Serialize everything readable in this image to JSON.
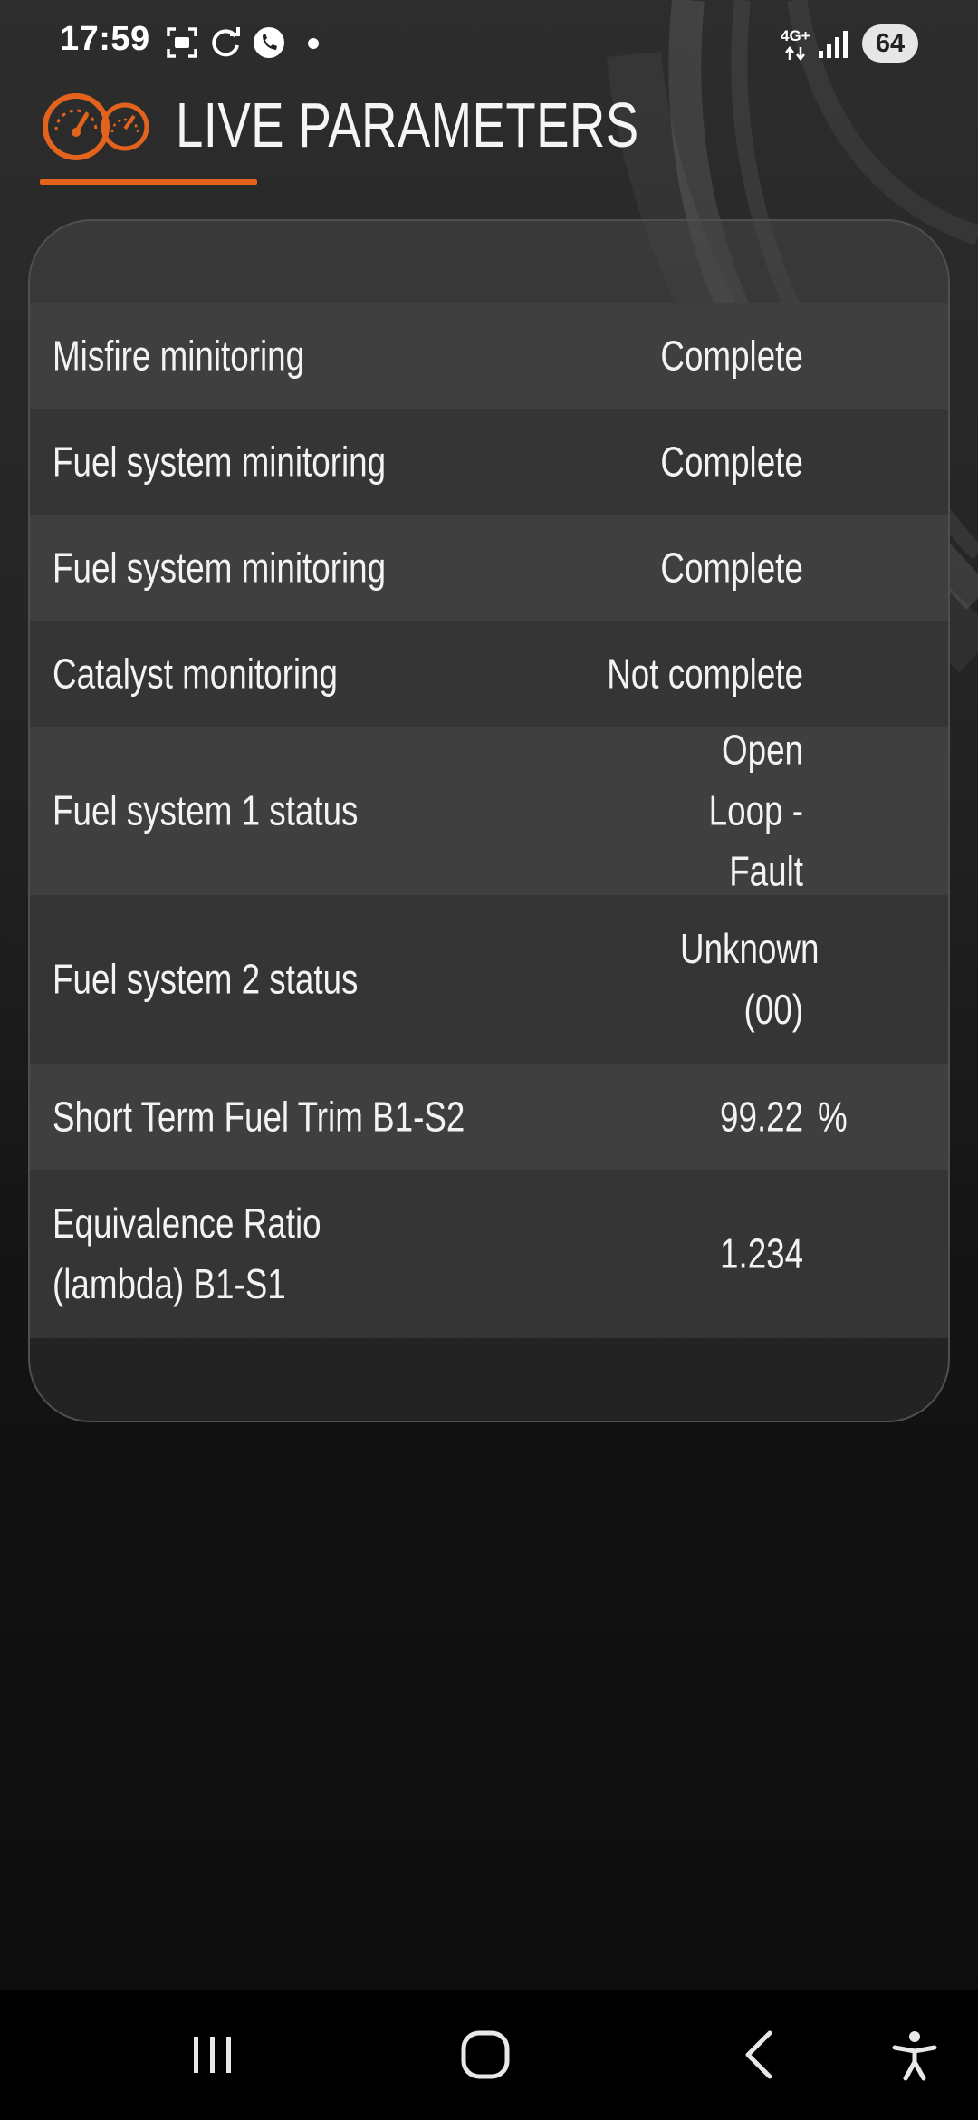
{
  "status_bar": {
    "time": "17:59",
    "icons": [
      "screenshot-icon",
      "sync-icon",
      "phone-call-icon",
      "notification-dot"
    ],
    "network_label": "4G+",
    "signal_icon": "signal-bars-icon",
    "battery": "64"
  },
  "header": {
    "logo_icon": "gauges-icon",
    "title": "LIVE PARAMETERS",
    "accent_color": "#e3621c"
  },
  "parameters": [
    {
      "label": "Misfire minitoring",
      "value": "Complete",
      "unit": ""
    },
    {
      "label": "Fuel system minitoring",
      "value": "Complete",
      "unit": ""
    },
    {
      "label": "Fuel system minitoring",
      "value": "Complete",
      "unit": ""
    },
    {
      "label": "Catalyst monitoring",
      "value": "Not complete",
      "unit": ""
    },
    {
      "label": "Fuel system 1 status",
      "value": "Open Loop - Fault",
      "unit": ""
    },
    {
      "label": "Fuel system 2 status",
      "value": "Unknown (00)",
      "unit": ""
    },
    {
      "label": "Short Term Fuel Trim B1-S2",
      "value": "99.22",
      "unit": "%"
    },
    {
      "label": "Equivalence Ratio (lambda) B1-S1",
      "value": "1.234",
      "unit": ""
    }
  ],
  "nav_bar": {
    "recents": "recents-icon",
    "home": "home-icon",
    "back": "back-icon",
    "accessibility": "accessibility-icon"
  }
}
